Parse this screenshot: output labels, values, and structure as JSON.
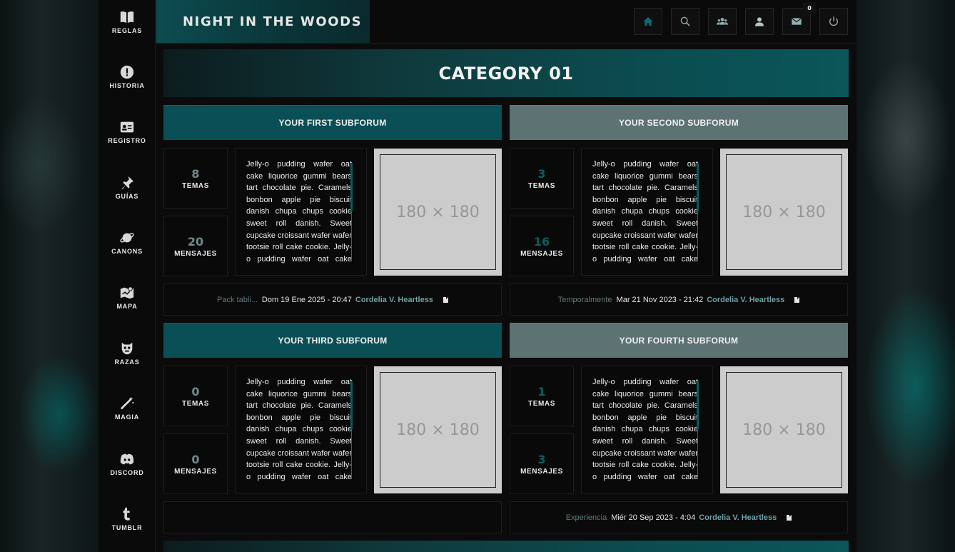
{
  "site": {
    "title": "NIGHT IN THE WOODS"
  },
  "sidebar": {
    "items": [
      {
        "label": "REGLAS",
        "icon": "book-icon"
      },
      {
        "label": "HISTORIA",
        "icon": "exclamation-icon"
      },
      {
        "label": "REGISTRO",
        "icon": "id-card-icon"
      },
      {
        "label": "GUÍAS",
        "icon": "pin-icon"
      },
      {
        "label": "CANONS",
        "icon": "planet-icon"
      },
      {
        "label": "MAPA",
        "icon": "map-icon"
      },
      {
        "label": "RAZAS",
        "icon": "creature-icon"
      },
      {
        "label": "MAGIA",
        "icon": "wand-icon"
      },
      {
        "label": "DISCORD",
        "icon": "discord-icon"
      },
      {
        "label": "TUMBLR",
        "icon": "tumblr-icon"
      }
    ]
  },
  "toolbar": {
    "buttons": [
      {
        "icon": "home-icon"
      },
      {
        "icon": "search-icon"
      },
      {
        "icon": "members-icon"
      },
      {
        "icon": "profile-icon"
      },
      {
        "icon": "mail-icon"
      },
      {
        "icon": "power-icon"
      }
    ],
    "mail_count": "0"
  },
  "category": {
    "title": "CATEGORY 01"
  },
  "subforums": [
    {
      "title": "YOUR FIRST SUBFORUM",
      "topics": "8",
      "topics_label": "TEMAS",
      "posts": "20",
      "posts_label": "MENSAJES",
      "description": "Jelly-o pudding wafer oat cake liquorice gummi bears tart chocolate pie. Caramels bonbon apple pie biscuit danish chupa chups cookie sweet roll danish. Sweet cupcake croissant wafer wafer tootsie roll cake cookie. Jelly-o pudding wafer oat cake liquorice.",
      "image_text": "180 × 180",
      "last_topic": "Pack tabli...",
      "last_date": "Dom 19 Ene 2025 - 20:47",
      "last_user": "Cordelia V. Heartless"
    },
    {
      "title": "YOUR SECOND SUBFORUM",
      "topics": "3",
      "topics_label": "TEMAS",
      "posts": "16",
      "posts_label": "MENSAJES",
      "description": "Jelly-o pudding wafer oat cake liquorice gummi bears tart chocolate pie. Caramels bonbon apple pie biscuit danish chupa chups cookie sweet roll danish. Sweet cupcake croissant wafer wafer tootsie roll cake cookie. Jelly-o pudding wafer oat cake liquorice.",
      "image_text": "180 × 180",
      "last_topic": "Temporalmente",
      "last_date": "Mar 21 Nov 2023 - 21:42",
      "last_user": "Cordelia V. Heartless"
    },
    {
      "title": "YOUR THIRD SUBFORUM",
      "topics": "0",
      "topics_label": "TEMAS",
      "posts": "0",
      "posts_label": "MENSAJES",
      "description": "Jelly-o pudding wafer oat cake liquorice gummi bears tart chocolate pie. Caramels bonbon apple pie biscuit danish chupa chups cookie sweet roll danish. Sweet cupcake croissant wafer wafer tootsie roll cake cookie. Jelly-o pudding wafer oat cake liquorice.",
      "image_text": "180 × 180",
      "last_topic": "",
      "last_date": "",
      "last_user": ""
    },
    {
      "title": "YOUR FOURTH SUBFORUM",
      "topics": "1",
      "topics_label": "TEMAS",
      "posts": "3",
      "posts_label": "MENSAJES",
      "description": "Jelly-o pudding wafer oat cake liquorice gummi bears tart chocolate pie. Caramels bonbon apple pie biscuit danish chupa chups cookie sweet roll danish. Sweet cupcake croissant wafer wafer tootsie roll cake cookie. Jelly-o pudding wafer oat cake liquorice.",
      "image_text": "180 × 180",
      "last_topic": "Experiencia",
      "last_date": "Miér 20 Sep 2023 - 4:04",
      "last_user": "Cordelia V. Heartless"
    }
  ],
  "colors": {
    "accent": "#0a4f55",
    "muted": "#5c7273",
    "link": "#6ea0a8"
  }
}
